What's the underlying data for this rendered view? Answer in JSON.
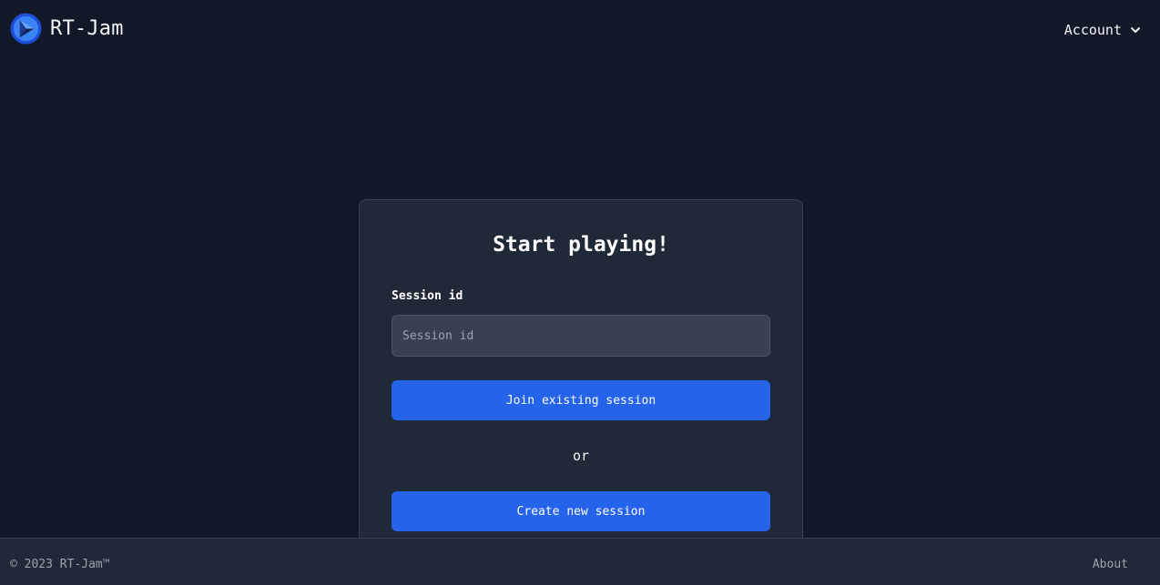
{
  "header": {
    "brand_name": "RT-Jam",
    "logo_icon": "play-logo-icon",
    "account_label": "Account",
    "account_icon": "chevron-down-icon"
  },
  "card": {
    "title": "Start playing!",
    "session_label": "Session id",
    "session_placeholder": "Session id",
    "session_value": "",
    "join_label": "Join existing session",
    "or_text": "or",
    "create_label": "Create new session"
  },
  "footer": {
    "copyright": "© 2023 RT-Jam™",
    "about_label": "About"
  },
  "colors": {
    "background": "#111827",
    "card": "#1f2937",
    "accent": "#2563eb",
    "input": "#374151",
    "muted_text": "#9ca3af"
  }
}
